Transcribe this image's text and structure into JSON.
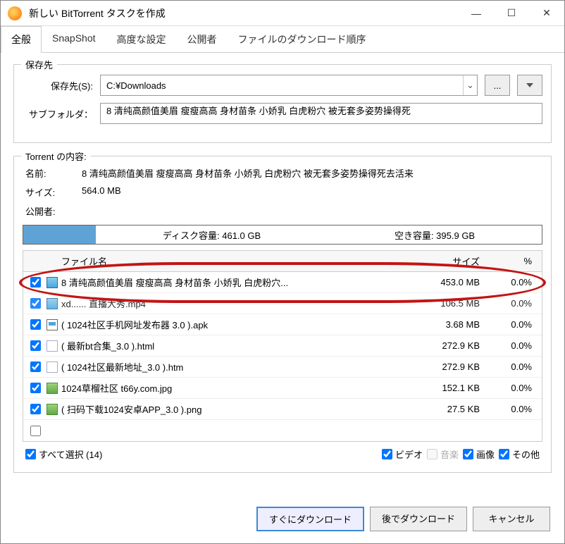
{
  "window": {
    "title": "新しい BitTorrent タスクを作成"
  },
  "tabs": {
    "general": "全般",
    "snapshot": "SnapShot",
    "advanced": "高度な設定",
    "publisher": "公開者",
    "order": "ファイルのダウンロード順序"
  },
  "save": {
    "legend": "保存先",
    "dest_label": "保存先(S):",
    "dest_value": "C:¥Downloads",
    "browse": "...",
    "subfolder_label": "サブフォルダ：",
    "subfolder_value": "8 清纯高颜值美眉 瘦瘦高高 身材苗条 小娇乳 白虎粉穴 被无套多姿势操得死"
  },
  "torrent": {
    "legend": "Torrent の内容:",
    "name_label": "名前:",
    "name_value": "8 清纯高颜值美眉 瘦瘦高高 身材苗条 小娇乳 白虎粉穴 被无套多姿势操得死去活来",
    "size_label": "サイズ:",
    "size_value": "564.0 MB",
    "publisher_label": "公開者:",
    "publisher_value": "",
    "disk_capacity": "ディスク容量: 461.0 GB",
    "disk_free": "空き容量: 395.9 GB",
    "columns": {
      "name": "ファイル名",
      "size": "サイズ",
      "pct": "%"
    },
    "files": [
      {
        "icon": "vid",
        "name": "8 清纯高颜值美眉 瘦瘦高高 身材苗条 小娇乳 白虎粉穴...",
        "size": "453.0 MB",
        "pct": "0.0%"
      },
      {
        "icon": "vid",
        "name": "xd...... 直播大秀.mp4",
        "size": "106.5 MB",
        "pct": "0.0%"
      },
      {
        "icon": "apk",
        "name": "( 1024社区手机网址发布器 3.0 ).apk",
        "size": "3.68 MB",
        "pct": "0.0%"
      },
      {
        "icon": "doc",
        "name": "(  最新bt合集_3.0 ).html",
        "size": "272.9 KB",
        "pct": "0.0%"
      },
      {
        "icon": "doc",
        "name": "(  1024社区最新地址_3.0 ).htm",
        "size": "272.9 KB",
        "pct": "0.0%"
      },
      {
        "icon": "img",
        "name": "1024草榴社区 t66y.com.jpg",
        "size": "152.1 KB",
        "pct": "0.0%"
      },
      {
        "icon": "img",
        "name": "( 扫码下载1024安卓APP_3.0 ).png",
        "size": "27.5 KB",
        "pct": "0.0%"
      }
    ],
    "select_all": "すべて選択 (14)",
    "filters": {
      "video": "ビデオ",
      "music": "音楽",
      "image": "画像",
      "other": "その他"
    }
  },
  "buttons": {
    "now": "すぐにダウンロード",
    "later": "後でダウンロード",
    "cancel": "キャンセル"
  }
}
